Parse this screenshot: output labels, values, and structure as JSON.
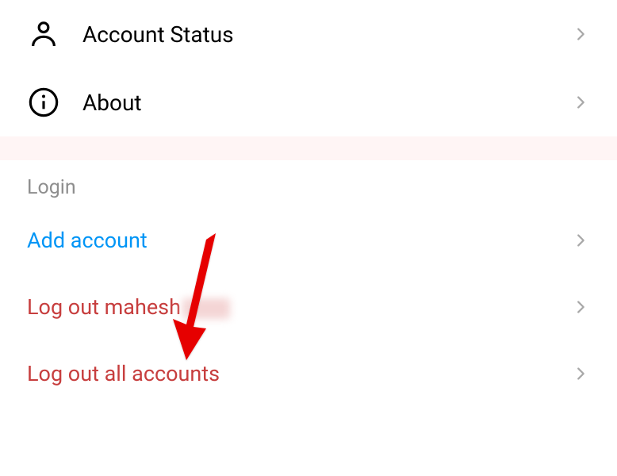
{
  "settings_items": [
    {
      "id": "account-status",
      "label": "Account Status",
      "icon": "person"
    },
    {
      "id": "about",
      "label": "About",
      "icon": "info"
    }
  ],
  "login_section": {
    "header": "Login",
    "items": [
      {
        "id": "add-account",
        "label": "Add account",
        "color": "blue"
      },
      {
        "id": "logout-user",
        "label": "Log out mahesh",
        "color": "red",
        "redacted": true
      },
      {
        "id": "logout-all",
        "label": "Log out all accounts",
        "color": "red"
      }
    ]
  }
}
